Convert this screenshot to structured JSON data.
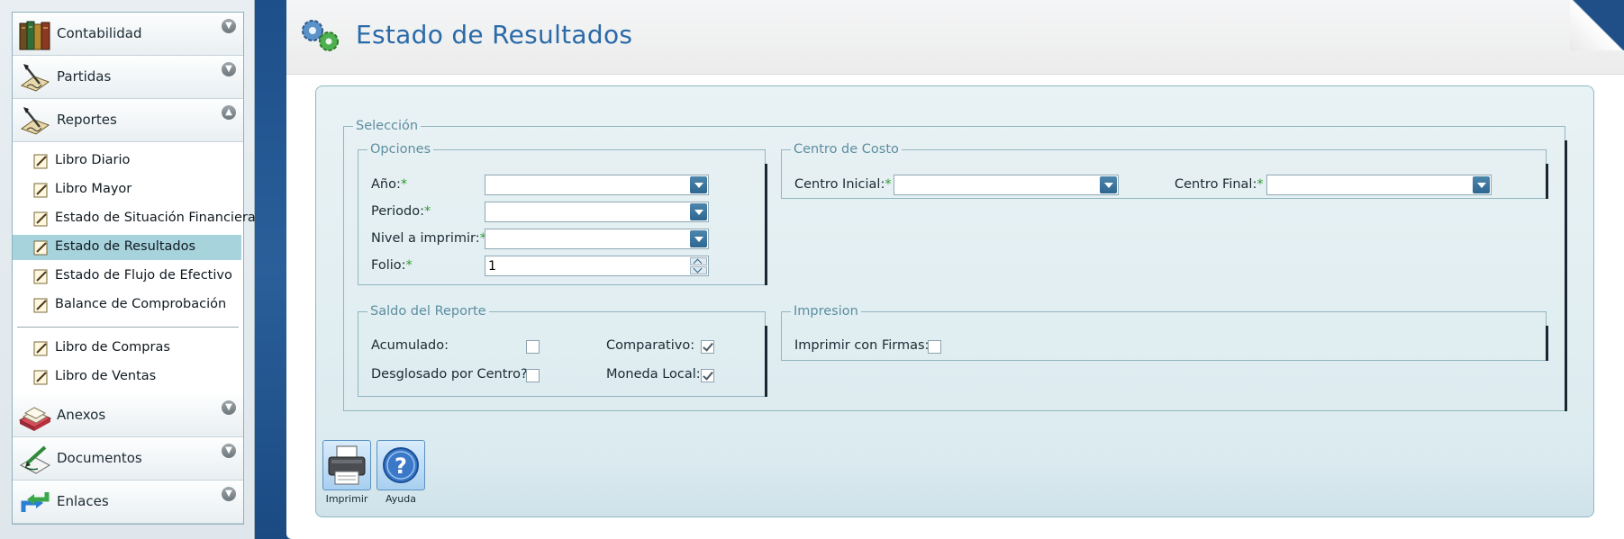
{
  "sidebar": {
    "sections": [
      {
        "label": "Contabilidad",
        "icon": "books-icon",
        "arrow": "down"
      },
      {
        "label": "Partidas",
        "icon": "quill-icon",
        "arrow": "down"
      },
      {
        "label": "Reportes",
        "icon": "quill-icon",
        "arrow": "up"
      },
      {
        "label": "Anexos",
        "icon": "tray-icon",
        "arrow": "down"
      },
      {
        "label": "Documentos",
        "icon": "pen-document-icon",
        "arrow": "down"
      },
      {
        "label": "Enlaces",
        "icon": "arrows-link-icon",
        "arrow": "down"
      }
    ],
    "report_items": [
      {
        "label": "Libro Diario"
      },
      {
        "label": "Libro Mayor"
      },
      {
        "label": "Estado de Situación Financiera"
      },
      {
        "label": "Estado de Resultados",
        "selected": true
      },
      {
        "label": "Estado de Flujo de Efectivo"
      },
      {
        "label": "Balance de Comprobación"
      },
      {
        "label": "Libro de Compras"
      },
      {
        "label": "Libro de Ventas"
      }
    ]
  },
  "header": {
    "title": "Estado de Resultados",
    "icon": "gears-icon"
  },
  "form": {
    "seleccion_legend": "Selección",
    "opciones": {
      "legend": "Opciones",
      "anio_label": "Año:",
      "periodo_label": "Periodo:",
      "nivel_label": "Nivel a imprimir:",
      "folio_label": "Folio:",
      "required_mark": "*",
      "anio_value": "",
      "periodo_value": "",
      "nivel_value": "",
      "folio_value": "1"
    },
    "centro_costo": {
      "legend": "Centro de Costo",
      "inicial_label": "Centro Inicial:",
      "final_label": "Centro Final:",
      "inicial_value": "",
      "final_value": ""
    },
    "saldo": {
      "legend": "Saldo del Reporte",
      "acumulado_label": "Acumulado:",
      "acumulado_checked": false,
      "comparativo_label": "Comparativo:",
      "comparativo_checked": true,
      "desglosado_label": "Desglosado por Centro?:",
      "desglosado_checked": false,
      "moneda_label": "Moneda Local:",
      "moneda_checked": true
    },
    "impresion": {
      "legend": "Impresion",
      "firmas_label": "Imprimir con Firmas:",
      "firmas_checked": false
    }
  },
  "toolbar": {
    "imprimir_label": "Imprimir",
    "ayuda_label": "Ayuda"
  },
  "colors": {
    "title": "#2a6aa8",
    "selected_item": "#a7d3dd",
    "required": "#2e9a2e"
  }
}
